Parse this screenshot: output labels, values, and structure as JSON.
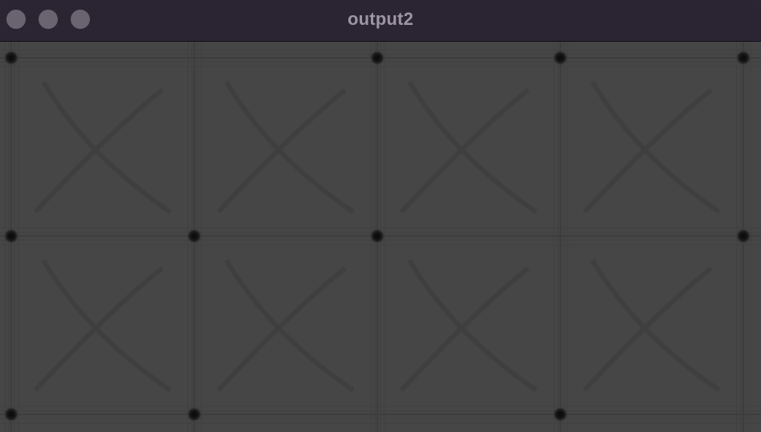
{
  "window": {
    "title": "output2"
  },
  "traffic_lights": {
    "close": "close-button",
    "minimize": "minimize-button",
    "zoom": "zoom-button"
  },
  "canvas": {
    "background": "#464646",
    "line_color": "#3a3a3a",
    "dot_color": "#111111"
  }
}
